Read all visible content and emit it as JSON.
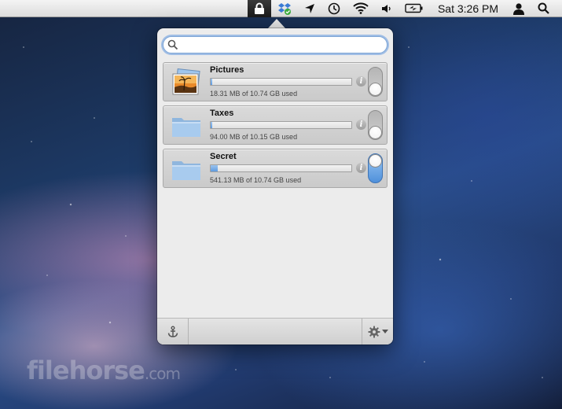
{
  "menubar": {
    "clock": "Sat 3:26 PM",
    "icons": [
      "lock-icon",
      "dropbox-icon",
      "location-arrow-icon",
      "time-machine-icon",
      "wifi-icon",
      "volume-icon",
      "battery-icon",
      "user-icon",
      "spotlight-icon"
    ]
  },
  "popover": {
    "search": {
      "value": "",
      "placeholder": ""
    },
    "vaults": [
      {
        "name": "Pictures",
        "usage": "18.31 MB of 10.74 GB used",
        "fill_fraction": 0.002,
        "icon": "photos-icon",
        "unlocked": false
      },
      {
        "name": "Taxes",
        "usage": "94.00 MB of 10.15 GB used",
        "fill_fraction": 0.009,
        "icon": "folder-icon",
        "unlocked": false
      },
      {
        "name": "Secret",
        "usage": "541.13 MB of 10.74 GB used",
        "fill_fraction": 0.05,
        "icon": "folder-icon",
        "unlocked": true
      }
    ],
    "info_glyph": "i",
    "footer": {
      "left_icon": "anchor-icon",
      "right_icon": "gear-icon"
    }
  },
  "watermark": {
    "brand": "filehorse",
    "suffix": ".com"
  },
  "colors": {
    "accent": "#4f90db",
    "popover_bg": "#ececec"
  }
}
